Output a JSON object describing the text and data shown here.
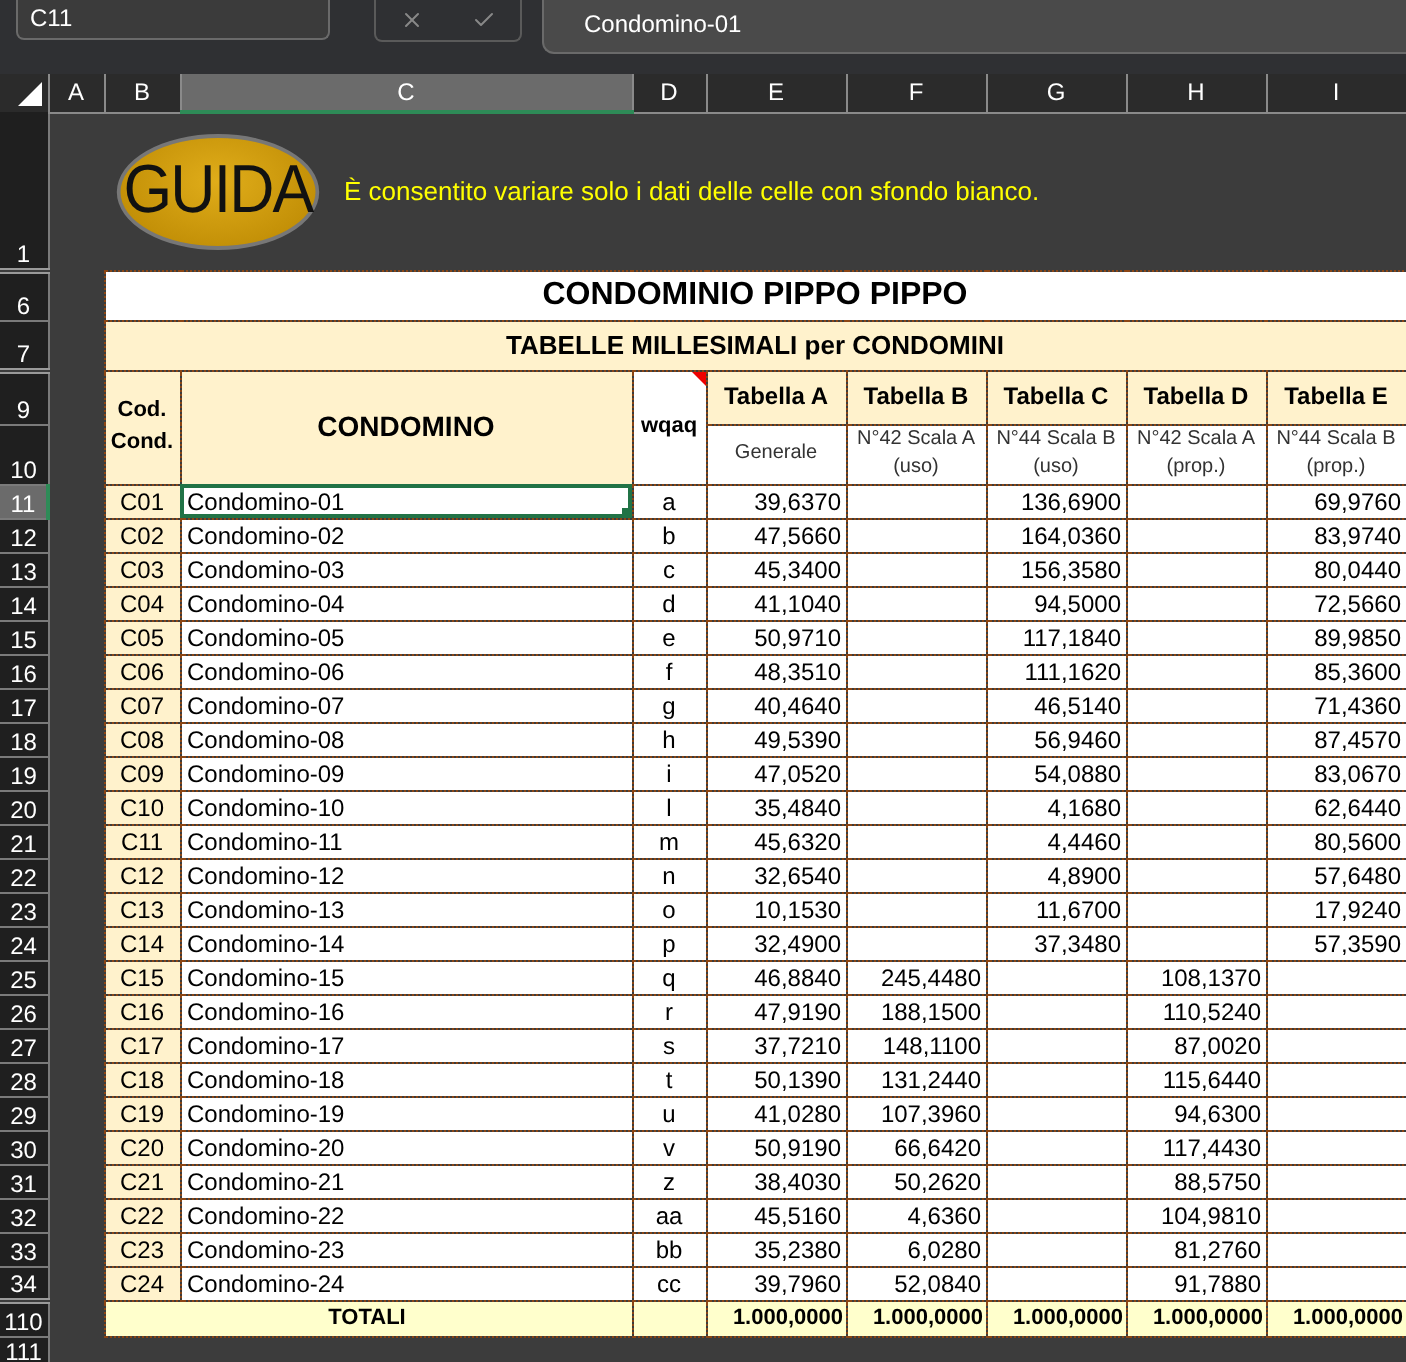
{
  "formula_bar": {
    "name_box": "C11",
    "formula": "Condomino-01"
  },
  "column_headers": [
    {
      "label": "A",
      "selected": false
    },
    {
      "label": "B",
      "selected": false
    },
    {
      "label": "C",
      "selected": true
    },
    {
      "label": "D",
      "selected": false
    },
    {
      "label": "E",
      "selected": false
    },
    {
      "label": "F",
      "selected": false
    },
    {
      "label": "G",
      "selected": false
    },
    {
      "label": "H",
      "selected": false
    },
    {
      "label": "I",
      "selected": false
    }
  ],
  "guide": {
    "row": "1",
    "button": "GUIDA",
    "message": "È consentito variare solo i dati delle celle con sfondo bianco."
  },
  "title": {
    "row": "6",
    "text": "CONDOMINIO PIPPO PIPPO"
  },
  "subtitle": {
    "row": "7",
    "text": "TABELLE MILLESIMALI per CONDOMINI"
  },
  "header": {
    "rows": [
      "9",
      "10"
    ],
    "code": "Cod. Cond.",
    "name": "CONDOMINO",
    "key": "wqaq",
    "key_has_comment": true,
    "tables": [
      {
        "title": "Tabella A",
        "subtitle": "Generale"
      },
      {
        "title": "Tabella B",
        "subtitle": "N°42 Scala A (uso)"
      },
      {
        "title": "Tabella C",
        "subtitle": "N°44 Scala B (uso)"
      },
      {
        "title": "Tabella D",
        "subtitle": "N°42 Scala A (prop.)"
      },
      {
        "title": "Tabella E",
        "subtitle": "N°44 Scala B (prop.)"
      }
    ]
  },
  "rows": [
    {
      "row": "11",
      "selected": true,
      "code": "C01",
      "name": "Condomino-01",
      "key": "a",
      "values": {
        "tabella_a": "39,6370",
        "tabella_c": "136,6900",
        "tabella_e": "69,9760"
      }
    },
    {
      "row": "12",
      "selected": false,
      "code": "C02",
      "name": "Condomino-02",
      "key": "b",
      "values": {
        "tabella_a": "47,5660",
        "tabella_c": "164,0360",
        "tabella_e": "83,9740"
      }
    },
    {
      "row": "13",
      "selected": false,
      "code": "C03",
      "name": "Condomino-03",
      "key": "c",
      "values": {
        "tabella_a": "45,3400",
        "tabella_c": "156,3580",
        "tabella_e": "80,0440"
      }
    },
    {
      "row": "14",
      "selected": false,
      "code": "C04",
      "name": "Condomino-04",
      "key": "d",
      "values": {
        "tabella_a": "41,1040",
        "tabella_c": "94,5000",
        "tabella_e": "72,5660"
      }
    },
    {
      "row": "15",
      "selected": false,
      "code": "C05",
      "name": "Condomino-05",
      "key": "e",
      "values": {
        "tabella_a": "50,9710",
        "tabella_c": "117,1840",
        "tabella_e": "89,9850"
      }
    },
    {
      "row": "16",
      "selected": false,
      "code": "C06",
      "name": "Condomino-06",
      "key": "f",
      "values": {
        "tabella_a": "48,3510",
        "tabella_c": "111,1620",
        "tabella_e": "85,3600"
      }
    },
    {
      "row": "17",
      "selected": false,
      "code": "C07",
      "name": "Condomino-07",
      "key": "g",
      "values": {
        "tabella_a": "40,4640",
        "tabella_c": "46,5140",
        "tabella_e": "71,4360"
      }
    },
    {
      "row": "18",
      "selected": false,
      "code": "C08",
      "name": "Condomino-08",
      "key": "h",
      "values": {
        "tabella_a": "49,5390",
        "tabella_c": "56,9460",
        "tabella_e": "87,4570"
      }
    },
    {
      "row": "19",
      "selected": false,
      "code": "C09",
      "name": "Condomino-09",
      "key": "i",
      "values": {
        "tabella_a": "47,0520",
        "tabella_c": "54,0880",
        "tabella_e": "83,0670"
      }
    },
    {
      "row": "20",
      "selected": false,
      "code": "C10",
      "name": "Condomino-10",
      "key": "l",
      "values": {
        "tabella_a": "35,4840",
        "tabella_c": "4,1680",
        "tabella_e": "62,6440"
      }
    },
    {
      "row": "21",
      "selected": false,
      "code": "C11",
      "name": "Condomino-11",
      "key": "m",
      "values": {
        "tabella_a": "45,6320",
        "tabella_c": "4,4460",
        "tabella_e": "80,5600"
      }
    },
    {
      "row": "22",
      "selected": false,
      "code": "C12",
      "name": "Condomino-12",
      "key": "n",
      "values": {
        "tabella_a": "32,6540",
        "tabella_c": "4,8900",
        "tabella_e": "57,6480"
      }
    },
    {
      "row": "23",
      "selected": false,
      "code": "C13",
      "name": "Condomino-13",
      "key": "o",
      "values": {
        "tabella_a": "10,1530",
        "tabella_c": "11,6700",
        "tabella_e": "17,9240"
      }
    },
    {
      "row": "24",
      "selected": false,
      "code": "C14",
      "name": "Condomino-14",
      "key": "p",
      "values": {
        "tabella_a": "32,4900",
        "tabella_c": "37,3480",
        "tabella_e": "57,3590"
      }
    },
    {
      "row": "25",
      "selected": false,
      "code": "C15",
      "name": "Condomino-15",
      "key": "q",
      "values": {
        "tabella_a": "46,8840",
        "tabella_b": "245,4480",
        "tabella_d": "108,1370"
      }
    },
    {
      "row": "26",
      "selected": false,
      "code": "C16",
      "name": "Condomino-16",
      "key": "r",
      "values": {
        "tabella_a": "47,9190",
        "tabella_b": "188,1500",
        "tabella_d": "110,5240"
      }
    },
    {
      "row": "27",
      "selected": false,
      "code": "C17",
      "name": "Condomino-17",
      "key": "s",
      "values": {
        "tabella_a": "37,7210",
        "tabella_b": "148,1100",
        "tabella_d": "87,0020"
      }
    },
    {
      "row": "28",
      "selected": false,
      "code": "C18",
      "name": "Condomino-18",
      "key": "t",
      "values": {
        "tabella_a": "50,1390",
        "tabella_b": "131,2440",
        "tabella_d": "115,6440"
      }
    },
    {
      "row": "29",
      "selected": false,
      "code": "C19",
      "name": "Condomino-19",
      "key": "u",
      "values": {
        "tabella_a": "41,0280",
        "tabella_b": "107,3960",
        "tabella_d": "94,6300"
      }
    },
    {
      "row": "30",
      "selected": false,
      "code": "C20",
      "name": "Condomino-20",
      "key": "v",
      "values": {
        "tabella_a": "50,9190",
        "tabella_b": "66,6420",
        "tabella_d": "117,4430"
      }
    },
    {
      "row": "31",
      "selected": false,
      "code": "C21",
      "name": "Condomino-21",
      "key": "z",
      "values": {
        "tabella_a": "38,4030",
        "tabella_b": "50,2620",
        "tabella_d": "88,5750"
      }
    },
    {
      "row": "32",
      "selected": false,
      "code": "C22",
      "name": "Condomino-22",
      "key": "aa",
      "values": {
        "tabella_a": "45,5160",
        "tabella_b": "4,6360",
        "tabella_d": "104,9810"
      }
    },
    {
      "row": "33",
      "selected": false,
      "code": "C23",
      "name": "Condomino-23",
      "key": "bb",
      "values": {
        "tabella_a": "35,2380",
        "tabella_b": "6,0280",
        "tabella_d": "81,2760"
      }
    },
    {
      "row": "34",
      "selected": false,
      "code": "C24",
      "name": "Condomino-24",
      "key": "cc",
      "values": {
        "tabella_a": "39,7960",
        "tabella_b": "52,0840",
        "tabella_d": "91,7880"
      }
    }
  ],
  "totals": {
    "row": "110",
    "label": "TOTALI",
    "values": [
      "1.000,0000",
      "1.000,0000",
      "1.000,0000",
      "1.000,0000",
      "1.000,0000"
    ]
  },
  "trailing_row": "111"
}
